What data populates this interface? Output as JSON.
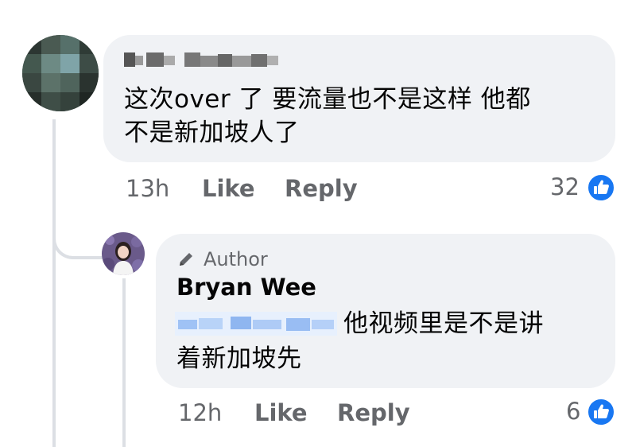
{
  "comment": {
    "text": "这次over 了 要流量也不是这样 他都\n不是新加坡人了",
    "time": "13h",
    "like_label": "Like",
    "reply_label": "Reply",
    "reaction_count": "32"
  },
  "reply": {
    "author_badge": "Author",
    "author_name": "Bryan Wee",
    "text_line1": "他视频里是不是讲",
    "text_line2": "着新加坡先",
    "time": "12h",
    "like_label": "Like",
    "reply_label": "Reply",
    "reaction_count": "6"
  },
  "colors": {
    "bubble": "#f0f2f5",
    "meta_text": "#65676b",
    "like_blue": "#1877f2",
    "thread_line": "#dcdfe4"
  },
  "icons": {
    "like": "thumbs-up-icon",
    "author": "pencil-icon"
  }
}
